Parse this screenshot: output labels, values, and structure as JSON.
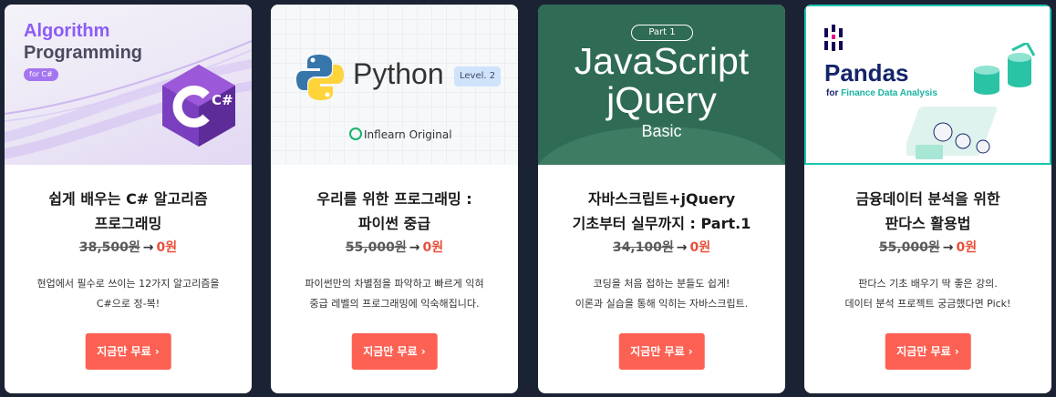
{
  "cards": [
    {
      "thumb": {
        "line1": "Algorithm",
        "line2": "Programming",
        "badge": "for C#",
        "logo": "C#"
      },
      "title_line1": "쉽게 배우는 C# 알고리즘",
      "title_line2": "프로그래밍",
      "old_price": "38,500원",
      "arrow": "→",
      "new_price": "0원",
      "desc_line1": "현업에서 필수로 쓰이는 12가지 알고리즘을",
      "desc_line2": "C#으로 정-복!",
      "button": "지금만 무료 ›"
    },
    {
      "thumb": {
        "name": "Python",
        "level": "Level. 2",
        "brand": "Inflearn Original"
      },
      "title_line1": "우리를 위한 프로그래밍 :",
      "title_line2": "파이썬 중급",
      "old_price": "55,000원",
      "arrow": "→",
      "new_price": "0원",
      "desc_line1": "파이썬만의 차별점을 파악하고 빠르게 익혀",
      "desc_line2": "중급 레벨의 프로그래밍에 익숙해집니다.",
      "button": "지금만 무료 ›"
    },
    {
      "thumb": {
        "part": "Part 1",
        "line1": "JavaScript",
        "line2": "jQuery",
        "level": "Basic"
      },
      "title_line1": "자바스크립트+jQuery",
      "title_line2": "기초부터 실무까지 : Part.1",
      "old_price": "34,100원",
      "arrow": "→",
      "new_price": "0원",
      "desc_line1": "코딩을 처음 접하는 분들도 쉽게!",
      "desc_line2": "이론과 실습을 통해 익히는 자바스크립트.",
      "button": "지금만 무료 ›"
    },
    {
      "thumb": {
        "name": "Pandas",
        "sub_prefix": "for ",
        "sub_rest": "Finance Data Analysis"
      },
      "title_line1": "금융데이터 분석을 위한",
      "title_line2": "판다스 활용법",
      "old_price": "55,000원",
      "arrow": "→",
      "new_price": "0원",
      "desc_line1": "판다스 기초 배우기 딱 좋은 강의.",
      "desc_line2": "데이터 분석 프로젝트 궁금했다면 Pick!",
      "button": "지금만 무료 ›"
    }
  ],
  "colors": {
    "background": "#1b2233",
    "button": "#fd6153",
    "free_price": "#e8503a",
    "javascript_green": "#2f6b55",
    "pandas_navy": "#14246b"
  }
}
